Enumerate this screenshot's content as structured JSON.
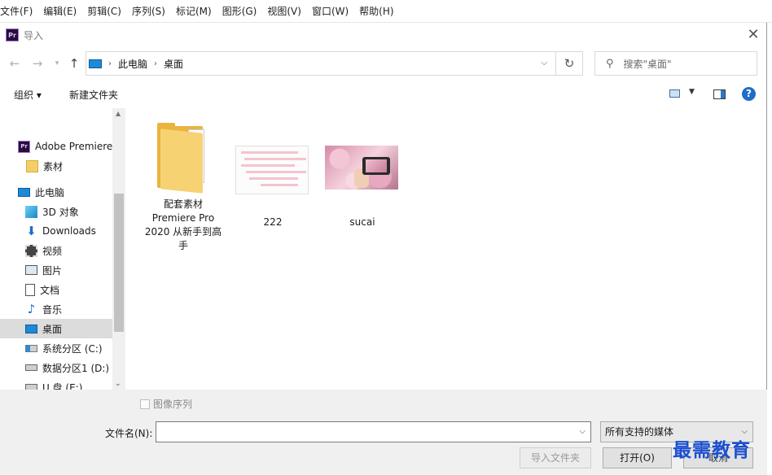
{
  "app_menu": [
    "文件(F)",
    "编辑(E)",
    "剪辑(C)",
    "序列(S)",
    "标记(M)",
    "图形(G)",
    "视图(V)",
    "窗口(W)",
    "帮助(H)"
  ],
  "dialog": {
    "title": "导入",
    "breadcrumb": [
      "此电脑",
      "桌面"
    ],
    "search_placeholder": "搜索\"桌面\"",
    "toolbar": {
      "organize": "组织 ▾",
      "new_folder": "新建文件夹"
    },
    "nav_items": [
      {
        "label": "Adobe Premiere",
        "icon": "premiere-icon"
      },
      {
        "label": "素材",
        "icon": "folder-icon"
      },
      {
        "label": "此电脑",
        "icon": "computer-icon"
      },
      {
        "label": "3D 对象",
        "icon": "3d-objects-icon"
      },
      {
        "label": "Downloads",
        "icon": "download-arrow-icon"
      },
      {
        "label": "视频",
        "icon": "video-icon"
      },
      {
        "label": "图片",
        "icon": "pictures-icon"
      },
      {
        "label": "文档",
        "icon": "documents-icon"
      },
      {
        "label": "音乐",
        "icon": "music-note-icon"
      },
      {
        "label": "桌面",
        "icon": "desktop-icon",
        "selected": true
      },
      {
        "label": "系统分区 (C:)",
        "icon": "windows-drive-icon"
      },
      {
        "label": "数据分区1 (D:)",
        "icon": "drive-icon"
      },
      {
        "label": "U 盘 (E:)",
        "icon": "usb-drive-icon"
      }
    ],
    "nav_clipped": "U 盘 (E:)",
    "files": [
      {
        "name": "配套素材 Premiere Pro 2020 从新手到高手",
        "type": "folder"
      },
      {
        "name": "222",
        "type": "image"
      },
      {
        "name": "sucai",
        "type": "image"
      }
    ],
    "image_sequence_label": "图像序列",
    "filename_label": "文件名(N):",
    "filename_value": "",
    "filter_value": "所有支持的媒体",
    "buttons": {
      "import_folder": "导入文件夹",
      "open": "打开(O)",
      "cancel": "取消"
    }
  },
  "watermark": "最需教育",
  "colors": {
    "accent": "#1d6ec9",
    "folder": "#e9b53f",
    "selected": "#dcdcdc"
  }
}
